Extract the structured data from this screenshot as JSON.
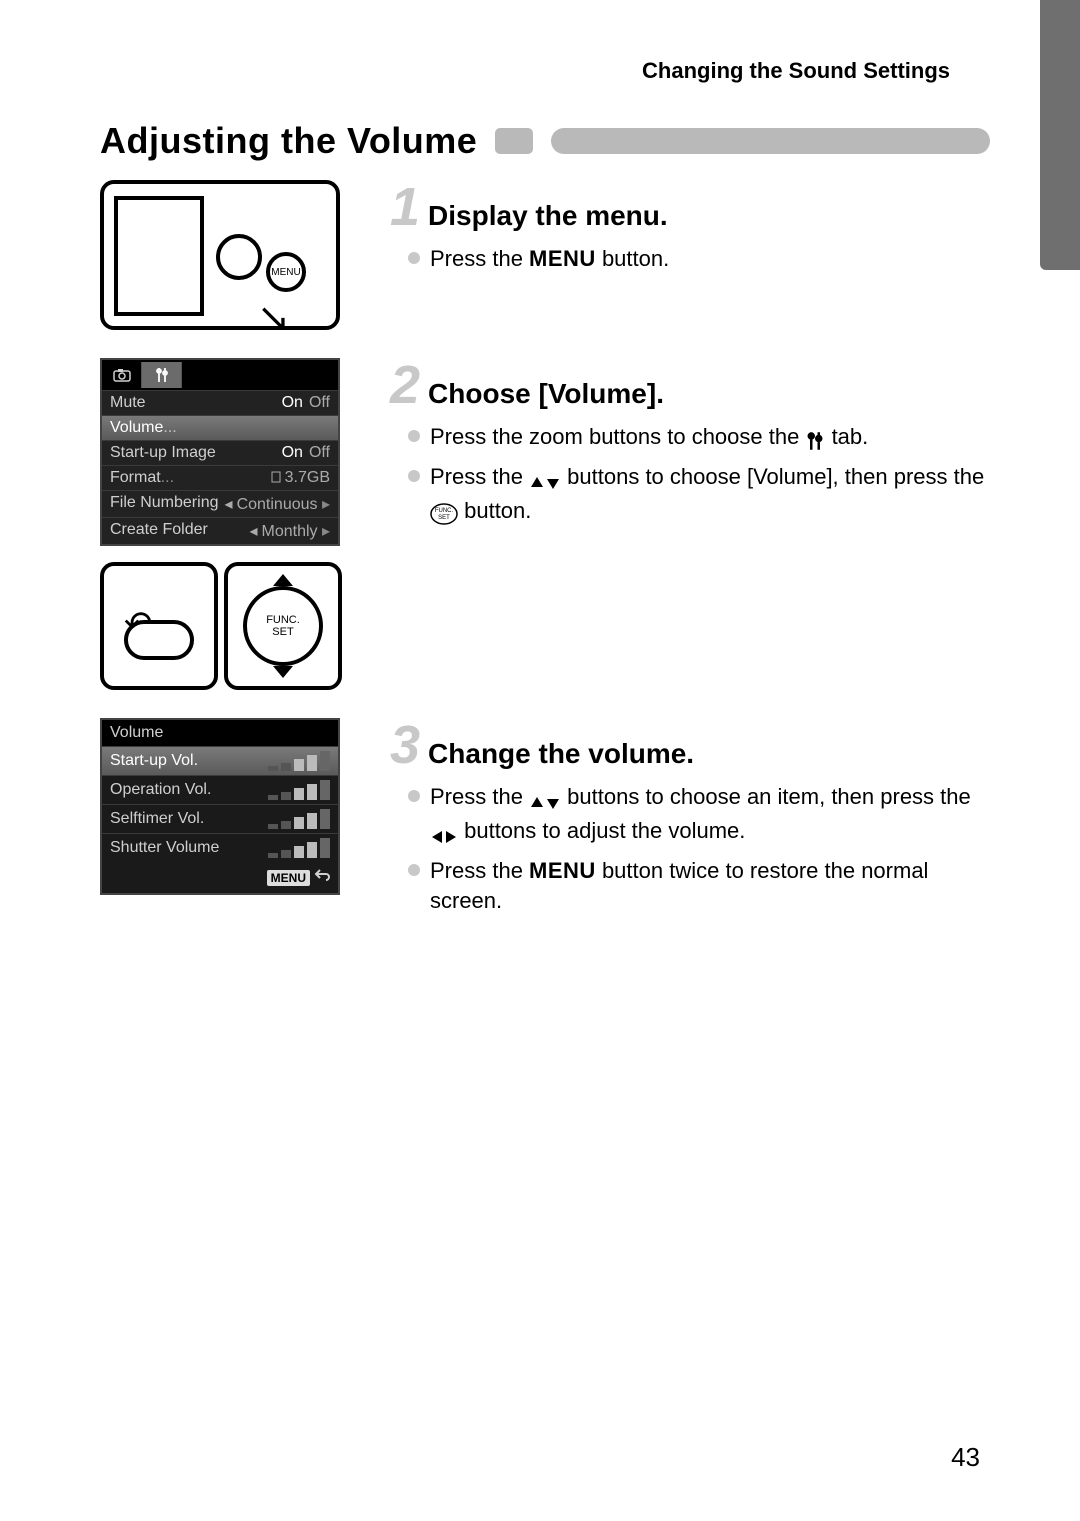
{
  "header": "Changing the Sound Settings",
  "section_title": "Adjusting the Volume",
  "page_number": "43",
  "steps": [
    {
      "num": "1",
      "title": "Display the menu.",
      "bullets": [
        {
          "parts": [
            "Press the ",
            {
              "icon": "menu-word",
              "text": "MENU"
            },
            " button."
          ]
        }
      ]
    },
    {
      "num": "2",
      "title": "Choose [Volume].",
      "bullets": [
        {
          "parts": [
            "Press the zoom buttons to choose the ",
            {
              "icon": "tools-icon"
            },
            " tab."
          ]
        },
        {
          "parts": [
            "Press the ",
            {
              "icon": "updown-tri"
            },
            " buttons to choose [Volume], then press the ",
            {
              "icon": "funcset"
            },
            " button."
          ]
        }
      ]
    },
    {
      "num": "3",
      "title": "Change the volume.",
      "bullets": [
        {
          "parts": [
            "Press the ",
            {
              "icon": "updown-tri"
            },
            " buttons to choose an item, then press the ",
            {
              "icon": "leftright-tri"
            },
            " buttons to adjust the volume."
          ]
        },
        {
          "parts": [
            "Press the ",
            {
              "icon": "menu-word",
              "text": "MENU"
            },
            " button twice to restore the normal screen."
          ]
        }
      ]
    }
  ],
  "menu_screenshot": {
    "tabs": [
      "camera",
      "tools"
    ],
    "active_tab": 1,
    "rows": [
      {
        "label": "Mute",
        "value_on": "On",
        "value_off": "Off"
      },
      {
        "label": "Volume",
        "value": "",
        "selected": true,
        "ellipsis": true
      },
      {
        "label": "Start-up Image",
        "value_on": "On",
        "value_off": "Off"
      },
      {
        "label": "Format",
        "value": "3.7GB",
        "ellipsis": true,
        "icon": "card"
      },
      {
        "label": "File Numbering",
        "value": "Continuous",
        "arrow": true
      },
      {
        "label": "Create Folder",
        "value": "Monthly",
        "arrow": true
      }
    ]
  },
  "volume_screenshot": {
    "title": "Volume",
    "rows": [
      {
        "label": "Start-up Vol.",
        "level": 2,
        "selected": true
      },
      {
        "label": "Operation Vol.",
        "level": 2
      },
      {
        "label": "Selftimer Vol.",
        "level": 2
      },
      {
        "label": "Shutter Volume",
        "level": 2
      }
    ],
    "footer_badge": "MENU",
    "footer_icon": "return"
  },
  "lineart_labels": {
    "menu_btn": "MENU",
    "func_set": "FUNC.\nSET"
  }
}
